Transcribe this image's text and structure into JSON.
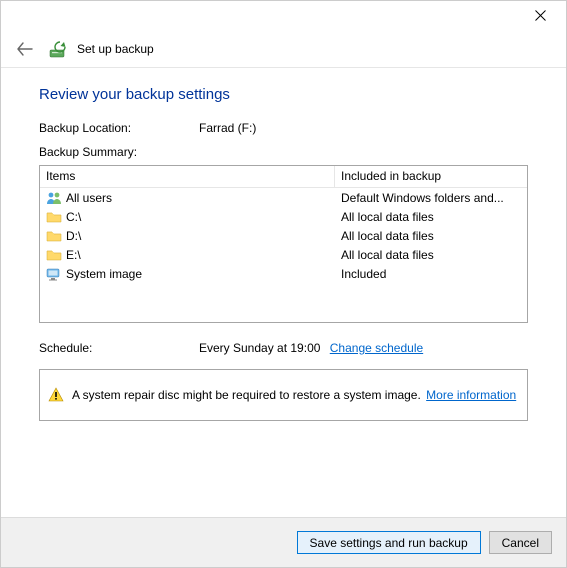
{
  "window": {
    "title": "Set up backup"
  },
  "heading": "Review your backup settings",
  "backup_location": {
    "label": "Backup Location:",
    "value": "Farrad (F:)"
  },
  "summary": {
    "label": "Backup Summary:",
    "headers": {
      "items": "Items",
      "included": "Included in backup"
    },
    "rows": [
      {
        "icon": "users-icon",
        "item": "All users",
        "included": "Default Windows folders and..."
      },
      {
        "icon": "folder-icon",
        "item": "C:\\",
        "included": "All local data files"
      },
      {
        "icon": "folder-icon",
        "item": "D:\\",
        "included": "All local data files"
      },
      {
        "icon": "folder-icon",
        "item": "E:\\",
        "included": "All local data files"
      },
      {
        "icon": "sysimage-icon",
        "item": "System image",
        "included": "Included"
      }
    ]
  },
  "schedule": {
    "label": "Schedule:",
    "value": "Every Sunday at 19:00",
    "change_link": "Change schedule"
  },
  "info_box": {
    "text": "A system repair disc might be required to restore a system image.",
    "link": "More information"
  },
  "footer": {
    "primary": "Save settings and run backup",
    "cancel": "Cancel"
  }
}
